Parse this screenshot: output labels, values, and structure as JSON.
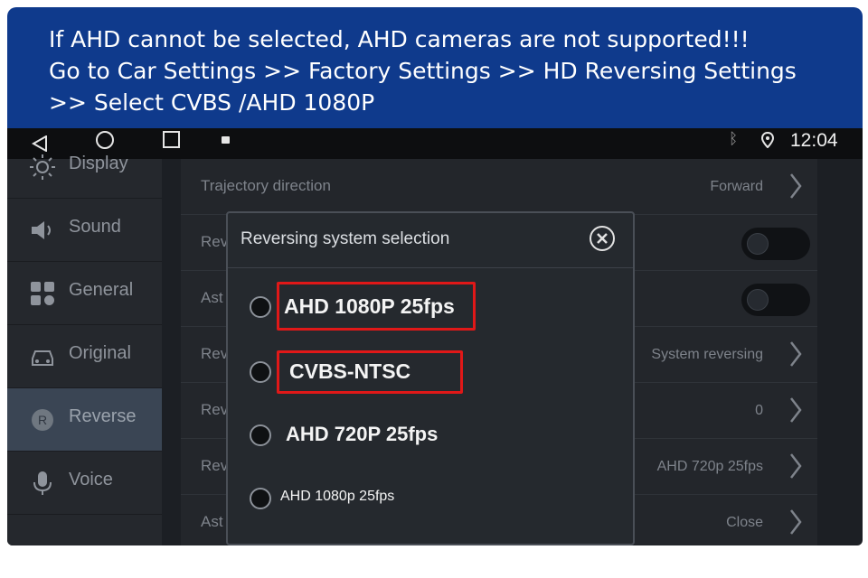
{
  "banner": {
    "line1": "If AHD cannot be selected, AHD cameras are not supported!!!",
    "line2": "Go to Car Settings >> Factory Settings >> HD Reversing Settings",
    "line3": ">> Select CVBS /AHD 1080P"
  },
  "statusbar": {
    "time": "12:04",
    "bluetooth_icon": "bluetooth-icon",
    "location_icon": "location-pin-icon"
  },
  "sidebar": {
    "items": [
      {
        "label": "Display",
        "icon": "brightness-icon"
      },
      {
        "label": "Sound",
        "icon": "speaker-icon"
      },
      {
        "label": "General",
        "icon": "grid-icon"
      },
      {
        "label": "Original",
        "icon": "car-icon"
      },
      {
        "label": "Reverse",
        "icon": "reverse-r-icon",
        "active": true
      },
      {
        "label": "Voice",
        "icon": "microphone-icon"
      }
    ]
  },
  "settings": {
    "rows": [
      {
        "label": "Trajectory direction",
        "value": "Forward"
      },
      {
        "label": "Rev",
        "value": ""
      },
      {
        "label": "Ast",
        "value": ""
      },
      {
        "label": "Rev",
        "value": "System reversing"
      },
      {
        "label": "Rev",
        "value": "0"
      },
      {
        "label": "Rev",
        "value": "AHD 720p 25fps"
      },
      {
        "label": "Ast",
        "value": "Close"
      }
    ]
  },
  "dialog": {
    "title": "Reversing system selection",
    "options": [
      {
        "label": "AHD 1080P 25fps",
        "highlighted": true
      },
      {
        "label": "CVBS-NTSC",
        "highlighted": true
      },
      {
        "label": "AHD 720P 25fps",
        "highlighted": false
      },
      {
        "label": "AHD 1080p 25fps",
        "highlighted": false
      }
    ]
  },
  "colors": {
    "banner_bg": "#0f3a8c",
    "highlight": "#e01818",
    "active_sidebar": "#3a4554"
  }
}
